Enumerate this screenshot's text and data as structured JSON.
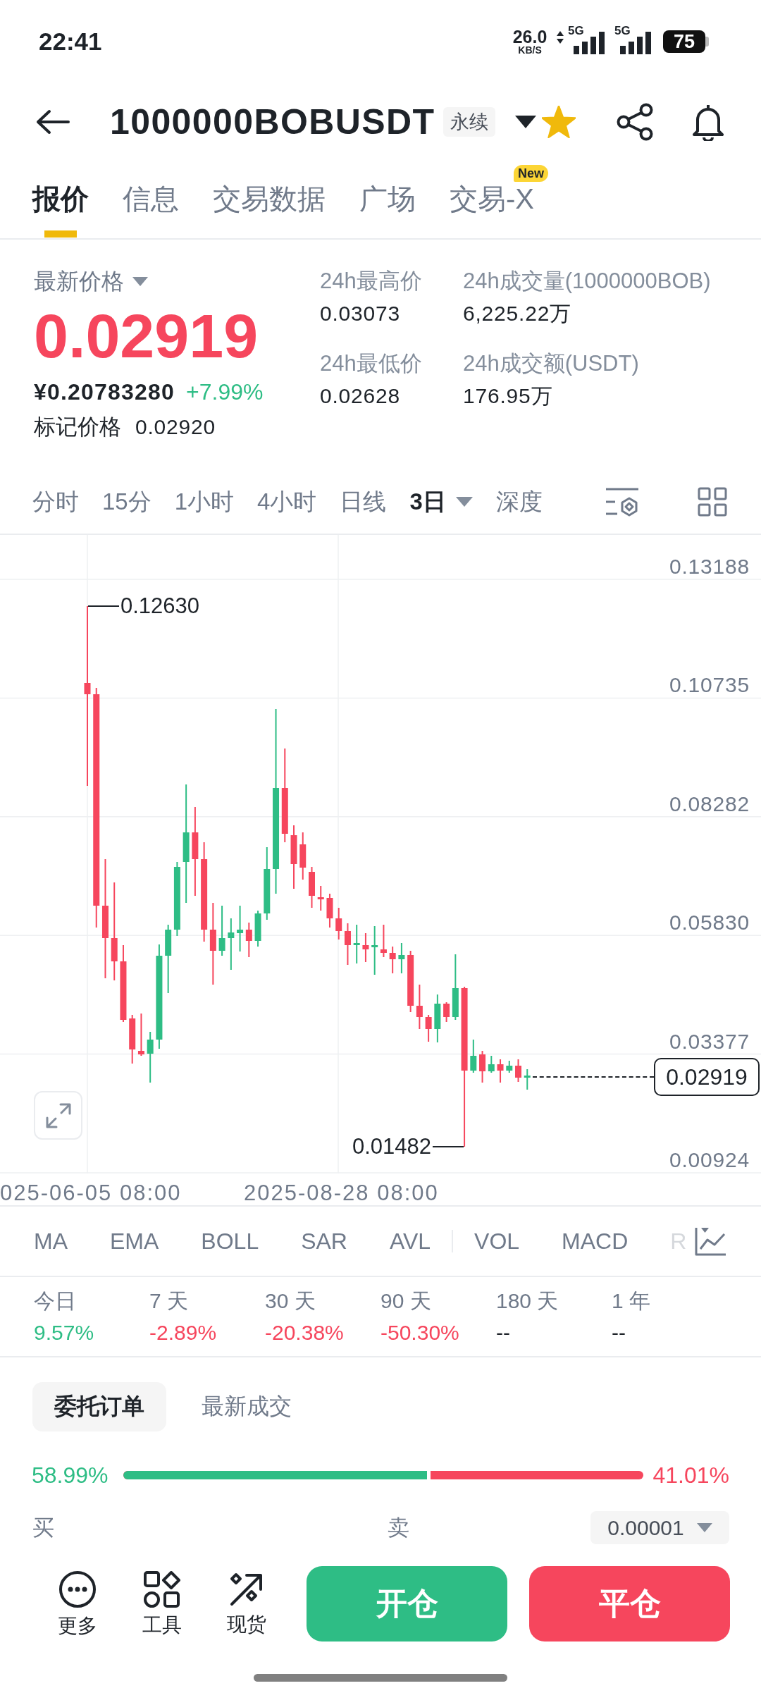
{
  "status_bar": {
    "time": "22:41",
    "net_speed": "26.0",
    "net_speed_unit": "KB/S",
    "networks": [
      "5G",
      "5G"
    ],
    "battery": "75"
  },
  "header": {
    "title": "1000000BOBUSDT",
    "badge": "永续",
    "favorite": true
  },
  "tabs": [
    {
      "label": "报价",
      "selected": true
    },
    {
      "label": "信息",
      "selected": false
    },
    {
      "label": "交易数据",
      "selected": false
    },
    {
      "label": "广场",
      "selected": false
    },
    {
      "label": "交易-X",
      "selected": false,
      "badge": "New"
    }
  ],
  "price": {
    "label": "最新价格",
    "last": "0.02919",
    "last_rising": false,
    "fiat": "¥0.20783280",
    "change": "+7.99%",
    "change_rising": true,
    "mark_label": "标记价格",
    "mark": "0.02920"
  },
  "stats": [
    {
      "label": "24h最高价",
      "value": "0.03073"
    },
    {
      "label": "24h成交量(1000000BOB)",
      "value": "6,225.22万"
    },
    {
      "label": "24h最低价",
      "value": "0.02628"
    },
    {
      "label": "24h成交额(USDT)",
      "value": "176.95万"
    }
  ],
  "intervals": [
    {
      "label": "分时",
      "selected": false,
      "menu": false
    },
    {
      "label": "15分",
      "selected": false,
      "menu": false
    },
    {
      "label": "1小时",
      "selected": false,
      "menu": false
    },
    {
      "label": "4小时",
      "selected": false,
      "menu": false
    },
    {
      "label": "日线",
      "selected": false,
      "menu": false
    },
    {
      "label": "3日",
      "selected": true,
      "menu": true
    },
    {
      "label": "深度",
      "selected": false,
      "menu": false
    }
  ],
  "chart": {
    "y_axis": [
      "0.13188",
      "0.10735",
      "0.08282",
      "0.05830",
      "0.03377",
      "0.00924"
    ],
    "x_axis": [
      "025-06-05 08:00",
      "2025-08-28 08:00"
    ],
    "high": "0.12630",
    "low": "0.01482",
    "last": "0.02919"
  },
  "indicators": {
    "main": [
      "MA",
      "EMA",
      "BOLL",
      "SAR",
      "AVL"
    ],
    "sub": [
      "VOL",
      "MACD",
      "R"
    ]
  },
  "periods": [
    {
      "label": "今日",
      "value": "9.57%",
      "color": "#2ebd85"
    },
    {
      "label": "7 天",
      "value": "-2.89%",
      "color": "#f6465d"
    },
    {
      "label": "30 天",
      "value": "-20.38%",
      "color": "#f6465d"
    },
    {
      "label": "90 天",
      "value": "-50.30%",
      "color": "#f6465d"
    },
    {
      "label": "180 天",
      "value": "--",
      "color": "#1e2329"
    },
    {
      "label": "1 年",
      "value": "--",
      "color": "#1e2329"
    }
  ],
  "book_tabs": [
    {
      "label": "委托订单",
      "selected": true
    },
    {
      "label": "最新成交",
      "selected": false
    }
  ],
  "ratio": {
    "buy": "58.99%",
    "sell": "41.01%",
    "level": 0.5899
  },
  "book_header": {
    "buy": "买",
    "sell": "卖",
    "precision": "0.00001"
  },
  "actions": [
    {
      "label": "更多",
      "kind": "more"
    },
    {
      "label": "工具",
      "kind": "tools"
    },
    {
      "label": "现货",
      "kind": "spot"
    }
  ],
  "trade_buttons": [
    {
      "label": "开仓",
      "kind": "open"
    },
    {
      "label": "平仓",
      "kind": "close"
    }
  ]
}
